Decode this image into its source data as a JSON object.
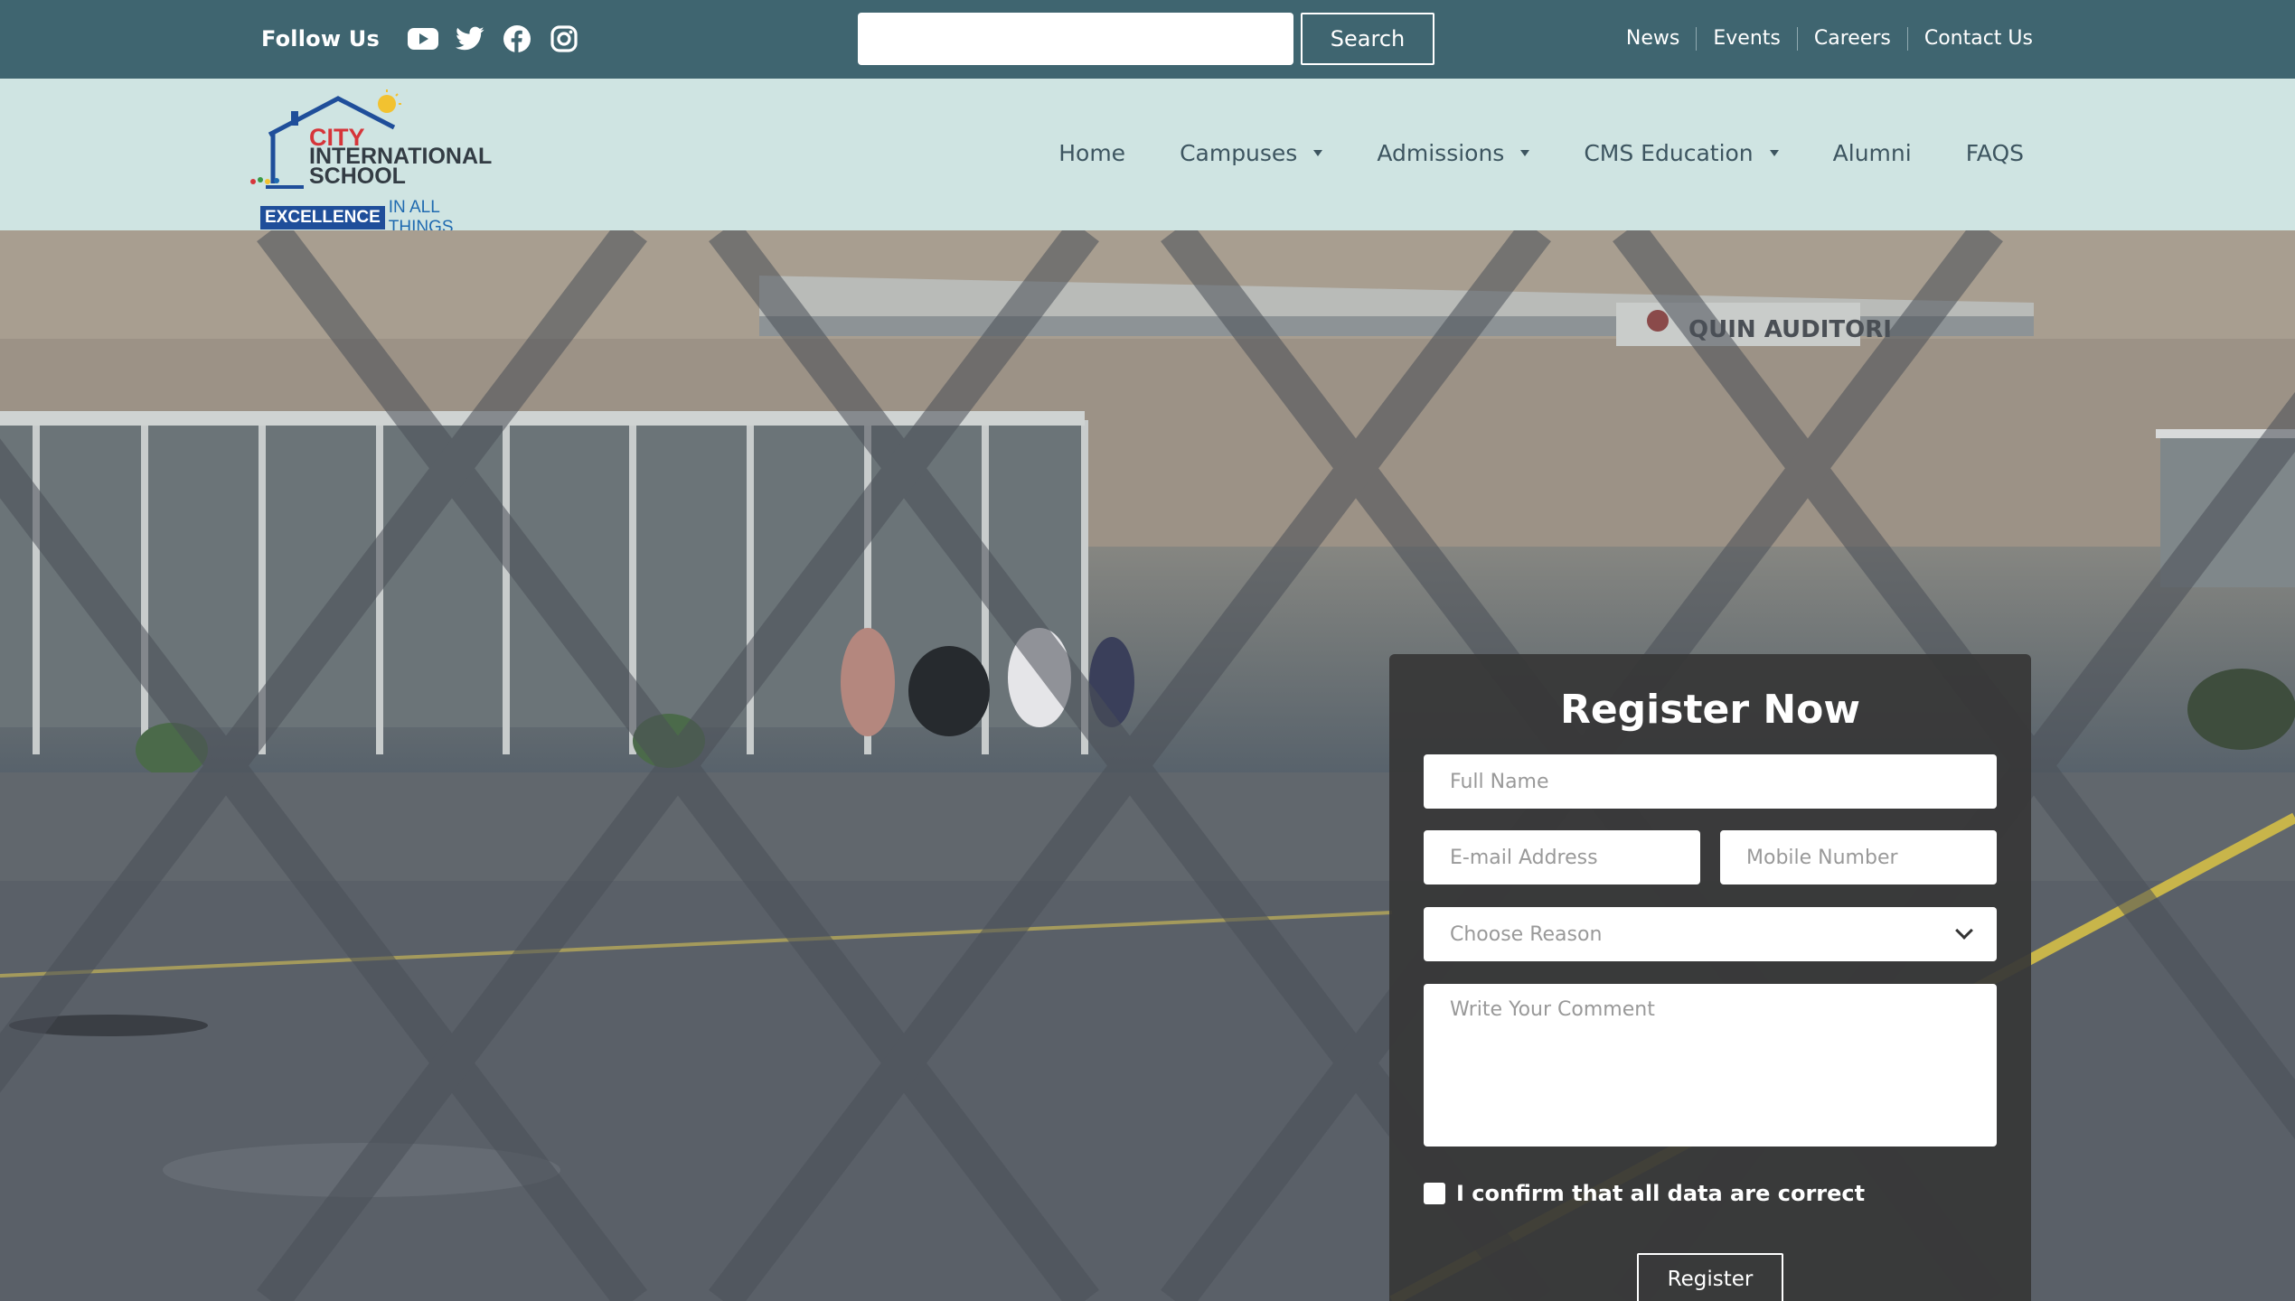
{
  "topbar": {
    "follow_label": "Follow Us",
    "socials": [
      {
        "icon": "youtube-icon"
      },
      {
        "icon": "twitter-icon"
      },
      {
        "icon": "facebook-icon"
      },
      {
        "icon": "instagram-icon"
      }
    ],
    "search": {
      "value": "",
      "placeholder": "",
      "button_label": "Search"
    },
    "links": [
      "News",
      "Events",
      "Careers",
      "Contact Us"
    ]
  },
  "header": {
    "logo": {
      "line1": "CITY",
      "line2": "INTERNATIONAL",
      "line3": "SCHOOL",
      "tag_highlight": "EXCELLENCE",
      "tag_rest": "IN ALL THINGS"
    },
    "nav": [
      {
        "label": "Home",
        "dropdown": false
      },
      {
        "label": "Campuses",
        "dropdown": true
      },
      {
        "label": "Admissions",
        "dropdown": true
      },
      {
        "label": "CMS Education",
        "dropdown": true
      },
      {
        "label": "Alumni",
        "dropdown": false
      },
      {
        "label": "FAQS",
        "dropdown": false
      }
    ]
  },
  "hero": {
    "sign_text": "QUIN AUDITORI"
  },
  "form": {
    "title": "Register Now",
    "full_name_placeholder": "Full Name",
    "email_placeholder": "E-mail Address",
    "mobile_placeholder": "Mobile Number",
    "reason_selected": "Choose Reason",
    "comment_placeholder": "Write Your Comment",
    "confirm_label": "I confirm that all data are correct",
    "register_label": "Register"
  },
  "colors": {
    "topbar_bg": "#3f6570",
    "header_bg": "#cfe4e2",
    "form_bg": "#373737",
    "logo_red": "#d6353a",
    "logo_blue": "#1f4e9a"
  }
}
